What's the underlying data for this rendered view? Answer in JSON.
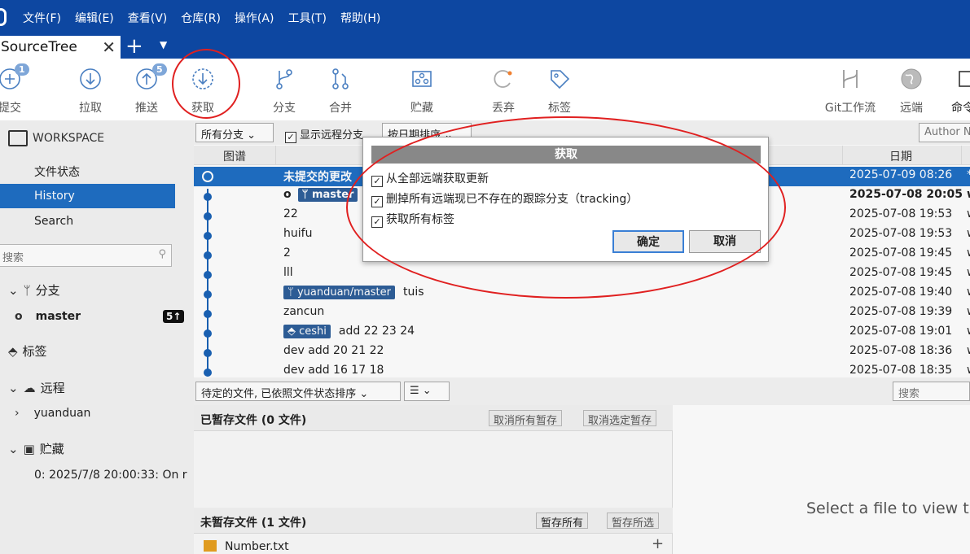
{
  "menu": [
    "文件(F)",
    "编辑(E)",
    "查看(V)",
    "仓库(R)",
    "操作(A)",
    "工具(T)",
    "帮助(H)"
  ],
  "tab": {
    "title": "SourceTree",
    "close": "✕",
    "add": "+",
    "menu": "▼"
  },
  "toolbar": {
    "commit": {
      "label": "提交",
      "badge": "1"
    },
    "pull": {
      "label": "拉取"
    },
    "push": {
      "label": "推送",
      "badge": "5"
    },
    "fetch": {
      "label": "获取"
    },
    "branch": {
      "label": "分支"
    },
    "merge": {
      "label": "合并"
    },
    "stash": {
      "label": "贮藏"
    },
    "discard": {
      "label": "丢弃"
    },
    "tag": {
      "label": "标签"
    },
    "gitflow": {
      "label": "Git工作流"
    },
    "remote": {
      "label": "远端"
    },
    "terminal": {
      "label": "命令行"
    }
  },
  "sidebar": {
    "workspace": "WORKSPACE",
    "items": [
      "文件状态",
      "History",
      "Search"
    ],
    "search_placeholder": "搜索",
    "branches": "分支",
    "branch_master": "master",
    "master_badge": "5↑",
    "tags": "标签",
    "remotes": "远程",
    "remote_name": "yuanduan",
    "stashes": "贮藏",
    "stash_item": "0: 2025/7/8 20:00:33: On r"
  },
  "filter": {
    "branches": "所有分支 ⌄",
    "show_remote": "显示远程分支",
    "sort": "按日期排序 ⌄",
    "author": "Author N"
  },
  "columns": {
    "graph": "图谱",
    "date": "日期"
  },
  "commits": [
    {
      "msg": "未提交的更改",
      "date": "2025-07-09 08:26",
      "auth": "*",
      "selected": true
    },
    {
      "msg": "",
      "tag": "master",
      "date": "2025-07-08 20:05",
      "auth": "w",
      "bold": true
    },
    {
      "msg": "22",
      "date": "2025-07-08 19:53",
      "auth": "w"
    },
    {
      "msg": "huifu",
      "date": "2025-07-08 19:53",
      "auth": "w"
    },
    {
      "msg": "2",
      "date": "2025-07-08 19:45",
      "auth": "w"
    },
    {
      "msg": "lll",
      "date": "2025-07-08 19:45",
      "auth": "w"
    },
    {
      "msg": "tuis",
      "tag": "yuanduan/master",
      "date": "2025-07-08 19:40",
      "auth": "w"
    },
    {
      "msg": "zancun",
      "date": "2025-07-08 19:39",
      "auth": "w"
    },
    {
      "msg": "add 22 23 24",
      "tag": "ceshi",
      "date": "2025-07-08 19:01",
      "auth": "w"
    },
    {
      "msg": "dev add 20 21 22",
      "date": "2025-07-08 18:36",
      "auth": "w"
    },
    {
      "msg": "dev add 16 17 18",
      "date": "2025-07-08 18:35",
      "auth": "w"
    }
  ],
  "lower": {
    "sort_select": "待定的文件, 已依照文件状态排序 ⌄",
    "view_select": "☰ ⌄",
    "search_placeholder": "搜索",
    "staged_title": "已暂存文件  (0 文件)",
    "unstage_all": "取消所有暂存",
    "unstage_selected": "取消选定暂存",
    "unstaged_title": "未暂存文件  (1 文件)",
    "stage_all": "暂存所有",
    "stage_selected": "暂存所选",
    "file": "Number.txt",
    "preview": "Select a file to view th"
  },
  "dialog": {
    "title": "获取",
    "opt1": "从全部远端获取更新",
    "opt2": "删掉所有远端现已不存在的跟踪分支（tracking）",
    "opt3": "获取所有标签",
    "ok": "确定",
    "cancel": "取消"
  }
}
